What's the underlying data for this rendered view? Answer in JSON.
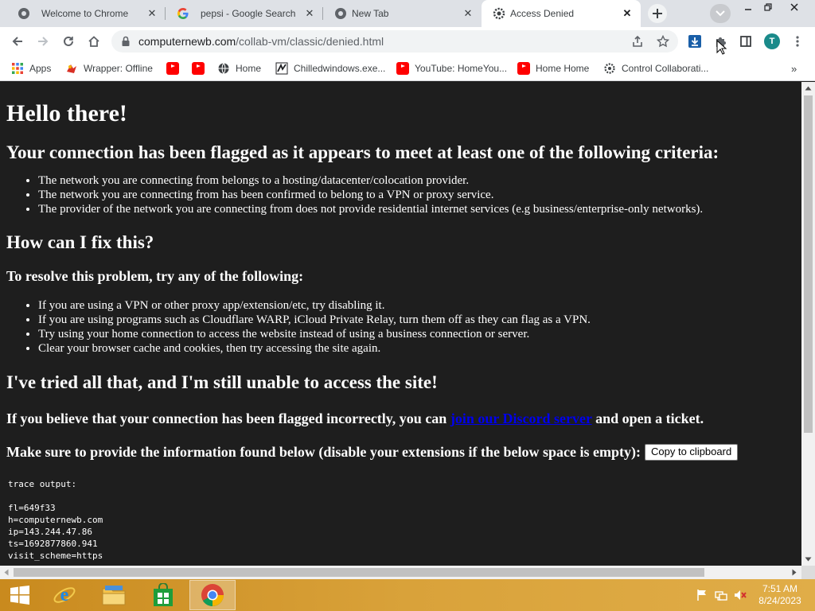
{
  "browser": {
    "tabs": [
      {
        "title": "Welcome to Chrome",
        "favicon": "chrome-icon",
        "active": false
      },
      {
        "title": "pepsi - Google Search",
        "favicon": "google-icon",
        "active": false
      },
      {
        "title": "New Tab",
        "favicon": "chrome-icon",
        "active": false
      },
      {
        "title": "Access Denied",
        "favicon": "gear-icon",
        "active": true
      }
    ],
    "url_host": "computernewb.com",
    "url_path": "/collab-vm/classic/denied.html",
    "profile_initial": "T",
    "bookmarks": [
      {
        "label": "Apps",
        "icon": "apps-grid-icon"
      },
      {
        "label": "Wrapper: Offline",
        "icon": "wrapper-icon"
      },
      {
        "label": "",
        "icon": "youtube-icon"
      },
      {
        "label": "",
        "icon": "youtube-icon"
      },
      {
        "label": "Home",
        "icon": "globe-icon"
      },
      {
        "label": "Chilledwindows.exe...",
        "icon": "chilledwindows-icon"
      },
      {
        "label": "YouTube: HomeYou...",
        "icon": "youtube-icon"
      },
      {
        "label": "Home Home",
        "icon": "youtube-icon"
      },
      {
        "label": "Control Collaborati...",
        "icon": "collab-icon"
      }
    ]
  },
  "page": {
    "heading": "Hello there!",
    "flagged_heading": "Your connection has been flagged as it appears to meet at least one of the following criteria:",
    "criteria": [
      "The network you are connecting from belongs to a hosting/datacenter/colocation provider.",
      "The network you are connecting from has been confirmed to belong to a VPN or proxy service.",
      "The provider of the network you are connecting from does not provide residential internet services (e.g business/enterprise-only networks)."
    ],
    "fix_heading": "How can I fix this?",
    "resolve_heading": "To resolve this problem, try any of the following:",
    "fixes": [
      "If you are using a VPN or other proxy app/extension/etc, try disabling it.",
      "If you are using programs such as Cloudflare WARP, iCloud Private Relay, turn them off as they can flag as a VPN.",
      "Try using your home connection to access the website instead of using a business connection or server.",
      "Clear your browser cache and cookies, then try accessing the site again."
    ],
    "tried_heading": "I've tried all that, and I'm still unable to access the site!",
    "incorrect_prefix": "If you believe that your connection has been flagged incorrectly, you can",
    "discord_link": "join our Discord server",
    "incorrect_suffix": "and open a ticket.",
    "provide_info": "Make sure to provide the information found below (disable your extensions if the below space is empty):",
    "copy_button": "Copy to clipboard",
    "trace_label": "trace output:",
    "trace_lines": [
      "fl=649f33",
      "h=computernewb.com",
      "ip=143.244.47.86",
      "ts=1692877860.941",
      "visit_scheme=https"
    ]
  },
  "taskbar": {
    "time": "7:51 AM",
    "date": "8/24/2023",
    "items": [
      "start-button",
      "internet-explorer",
      "file-explorer",
      "store",
      "chrome"
    ]
  },
  "colors": {
    "page_background": "#1e1e1e",
    "link": "#0000ee",
    "taskbar": "#d9a23a"
  }
}
